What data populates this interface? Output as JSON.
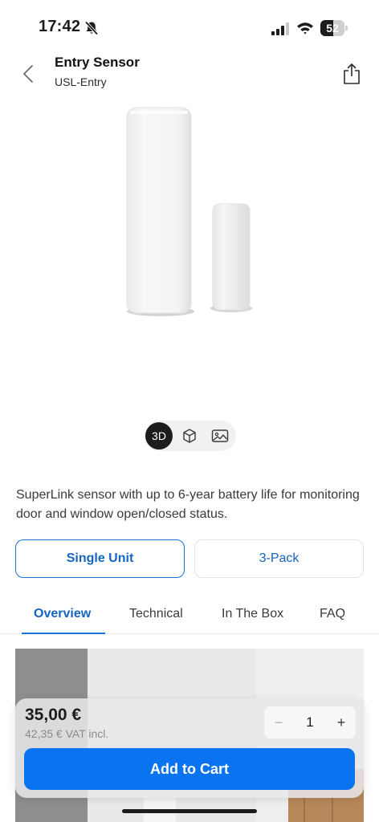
{
  "status_bar": {
    "time": "17:42",
    "battery_level": 52,
    "battery_label": "52",
    "icons": [
      "bell-slash-icon",
      "signal-icon",
      "wifi-icon",
      "battery-icon"
    ]
  },
  "header": {
    "title": "Entry Sensor",
    "subtitle": "USL-Entry",
    "back_icon": "chevron-left-icon",
    "share_icon": "share-icon"
  },
  "view_toggle": {
    "options": [
      {
        "label": "3D",
        "icon": "3d-icon",
        "selected": true
      },
      {
        "label": "",
        "icon": "cube-icon",
        "selected": false
      },
      {
        "label": "",
        "icon": "photo-icon",
        "selected": false
      }
    ]
  },
  "description": "SuperLink sensor with up to 6-year battery life for monitoring door and window open/closed status.",
  "variants": [
    {
      "label": "Single Unit",
      "selected": true
    },
    {
      "label": "3-Pack",
      "selected": false
    }
  ],
  "tabs": [
    {
      "label": "Overview",
      "active": true
    },
    {
      "label": "Technical",
      "active": false
    },
    {
      "label": "In The Box",
      "active": false
    },
    {
      "label": "FAQ",
      "active": false
    }
  ],
  "cart": {
    "price": "35,00 €",
    "vat_note": "42,35 € VAT incl.",
    "quantity": "1",
    "minus_symbol": "−",
    "plus_symbol": "+",
    "add_button_label": "Add to Cart"
  },
  "colors": {
    "accent": "#0a74f0",
    "link": "#1565c0",
    "text": "#1c1c1e",
    "muted": "#8a8a8e"
  }
}
